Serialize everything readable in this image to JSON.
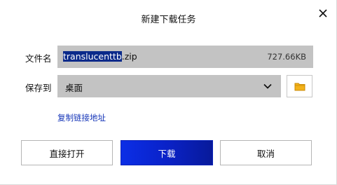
{
  "dialog": {
    "title": "新建下载任务",
    "close_icon": "close-icon"
  },
  "file": {
    "label": "文件名",
    "name_selected": "translucenttb",
    "name_rest": ".zip",
    "size": "727.66KB"
  },
  "save": {
    "label": "保存到",
    "value": "桌面",
    "dropdown_icon": "chevron-down-icon",
    "folder_icon": "folder-icon"
  },
  "copy_link_label": "复制链接地址",
  "buttons": {
    "open": "直接打开",
    "download": "下载",
    "cancel": "取消"
  },
  "colors": {
    "accent": "#0b2ee6",
    "field_bg": "#c3c3c3",
    "link": "#1535b8",
    "selection": "#0a2a8a",
    "folder": "#f3b21b"
  }
}
